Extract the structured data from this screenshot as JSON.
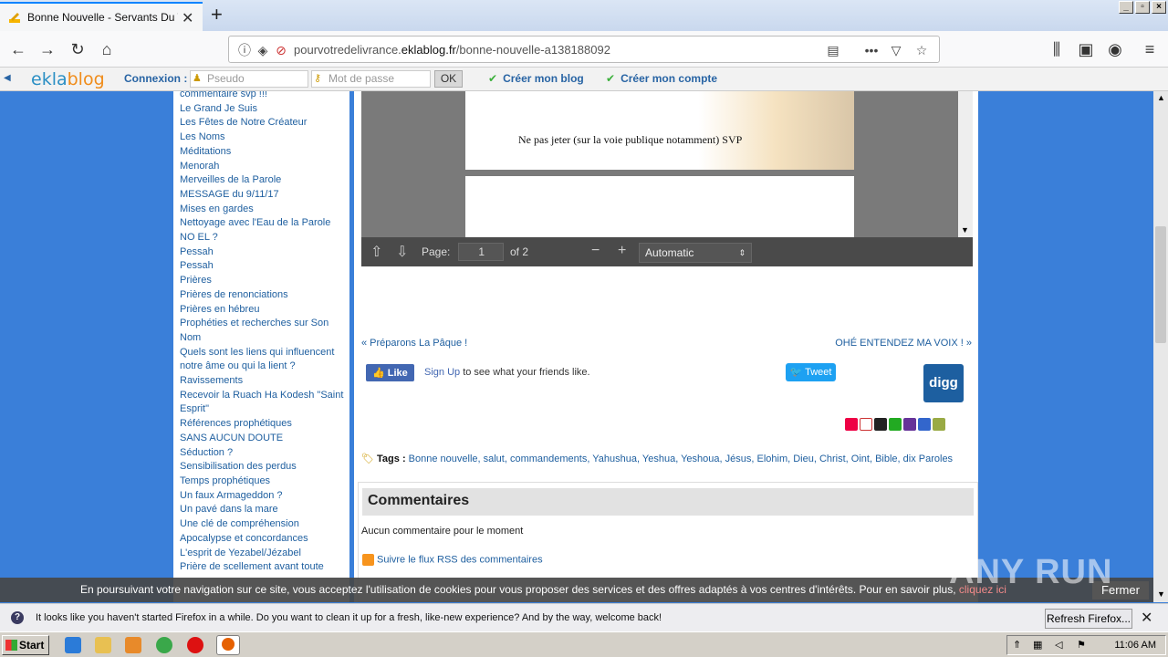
{
  "browser": {
    "tab_title": "Bonne Nouvelle - Servants Du Très",
    "url_prefix": "pourvotredelivrance.",
    "url_domain": "eklablog.fr",
    "url_path": "/bonne-nouvelle-a138188092",
    "new_tab": "+",
    "tab_close": "✕"
  },
  "eklabar": {
    "logo_a": "ekla",
    "logo_b": "blog",
    "connexion": "Connexion :",
    "pseudo_placeholder": "Pseudo",
    "password_placeholder": "Mot de passe",
    "ok": "OK",
    "create_blog": "Créer mon blog",
    "create_account": "Créer mon compte"
  },
  "sidebar": {
    "items": [
      "commentaire svp !!!",
      "Le Grand Je Suis",
      "Les Fêtes de Notre Créateur",
      "Les Noms",
      "Méditations",
      "Menorah",
      "Merveilles de la Parole",
      "MESSAGE du 9/11/17",
      "Mises en gardes",
      "Nettoyage avec l'Eau de la Parole",
      "NO EL ?",
      "Pessah",
      "Pessah",
      "Prières",
      "Prières de renonciations",
      "Prières en hébreu",
      "Prophéties et recherches sur Son",
      "Nom",
      "Quels sont les liens qui influencent",
      "notre âme ou qui la lient ?",
      "Ravissements",
      "Recevoir la Ruach Ha Kodesh \"Saint",
      "Esprit\"",
      "Références prophétiques",
      "SANS AUCUN DOUTE",
      "Séduction ?",
      "Sensibilisation des perdus",
      "Temps prophétiques",
      "Un faux Armageddon ?",
      "Un pavé dans la mare",
      "Une clé de compréhension",
      "Apocalypse et concordances",
      "L'esprit de Yezabel/Jézabel",
      "Prière de scellement avant toute"
    ]
  },
  "pdf": {
    "page_text": "Ne pas jeter (sur la voie publique notamment) SVP",
    "page_label": "Page:",
    "page_value": "1",
    "of_label": "of 2",
    "zoom": "Automatic",
    "zoom_out": "−",
    "zoom_in": "+"
  },
  "post": {
    "prev_link": "« Préparons La Pâque !",
    "next_link": "OHÉ ENTENDEZ MA VOIX ! »",
    "fb_like": "Like",
    "fb_signup": "Sign Up",
    "fb_rest": " to see what your friends like.",
    "tweet": "Tweet",
    "digg": "digg",
    "tags_label": "Tags :",
    "tags": "Bonne nouvelle, salut, commandements, Yahushua, Yeshua, Yeshoua, Jésus, Elohim, Dieu, Christ, Oint, Bible, dix Paroles"
  },
  "comments": {
    "header": "Commentaires",
    "none": "Aucun commentaire pour le moment",
    "rss": "Suivre le flux RSS des commentaires"
  },
  "cookie": {
    "message": "En poursuivant votre navigation sur ce site, vous acceptez l'utilisation de cookies pour vous proposer des services et des offres adaptés à vos centres d'intérêts. Pour en savoir plus, ",
    "link": "cliquez ici",
    "close": "Fermer"
  },
  "watermark": "ANY RUN",
  "notification": {
    "text": "It looks like you haven't started Firefox in a while. Do you want to clean it up for a fresh, like-new experience? And by the way, welcome back!",
    "button": "Refresh Firefox...",
    "close": "✕"
  },
  "taskbar": {
    "start": "Start",
    "clock": "11:06 AM"
  }
}
